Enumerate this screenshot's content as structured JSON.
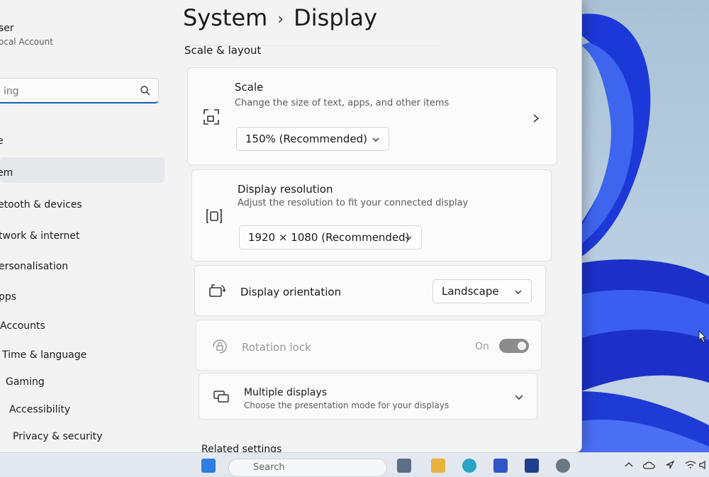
{
  "user": {
    "name": "ser",
    "account_type": "ocal Account"
  },
  "search": {
    "placeholder": "ing"
  },
  "sidebar": {
    "items": [
      {
        "label": "e",
        "icon": "home-icon"
      },
      {
        "label": "em",
        "icon": "system-icon",
        "active": true
      },
      {
        "label": "etooth & devices",
        "icon": "bluetooth-icon"
      },
      {
        "label": "twork & internet",
        "icon": "network-icon"
      },
      {
        "label": "ersonalisation",
        "icon": "brush-icon"
      },
      {
        "label": "pps",
        "icon": "apps-icon"
      },
      {
        "label": "Accounts",
        "icon": "person-icon"
      },
      {
        "label": "Time & language",
        "icon": "clock-icon"
      },
      {
        "label": "Gaming",
        "icon": "controller-icon"
      },
      {
        "label": "Accessibility",
        "icon": "accessibility-icon"
      },
      {
        "label": "Privacy & security",
        "icon": "shield-icon"
      }
    ]
  },
  "header": {
    "parent": "System",
    "separator": "›",
    "current": "Display"
  },
  "section": {
    "title": "Scale & layout"
  },
  "scale": {
    "title": "Scale",
    "description": "Change the size of text, apps, and other items",
    "value": "150% (Recommended)"
  },
  "resolution": {
    "title": "Display resolution",
    "description": "Adjust the resolution to fit your connected display",
    "value": "1920 × 1080 (Recommended)"
  },
  "orientation": {
    "title": "Display orientation",
    "value": "Landscape"
  },
  "rotation_lock": {
    "title": "Rotation lock",
    "state_label": "On",
    "enabled": false
  },
  "multiple_displays": {
    "title": "Multiple displays",
    "description": "Choose the presentation mode for your displays"
  },
  "related": {
    "title": "Related settings"
  },
  "taskbar": {
    "search_placeholder": "Search"
  },
  "colors": {
    "accent": "#005fb8",
    "wallpaper_blue": "#1a3fd4"
  }
}
